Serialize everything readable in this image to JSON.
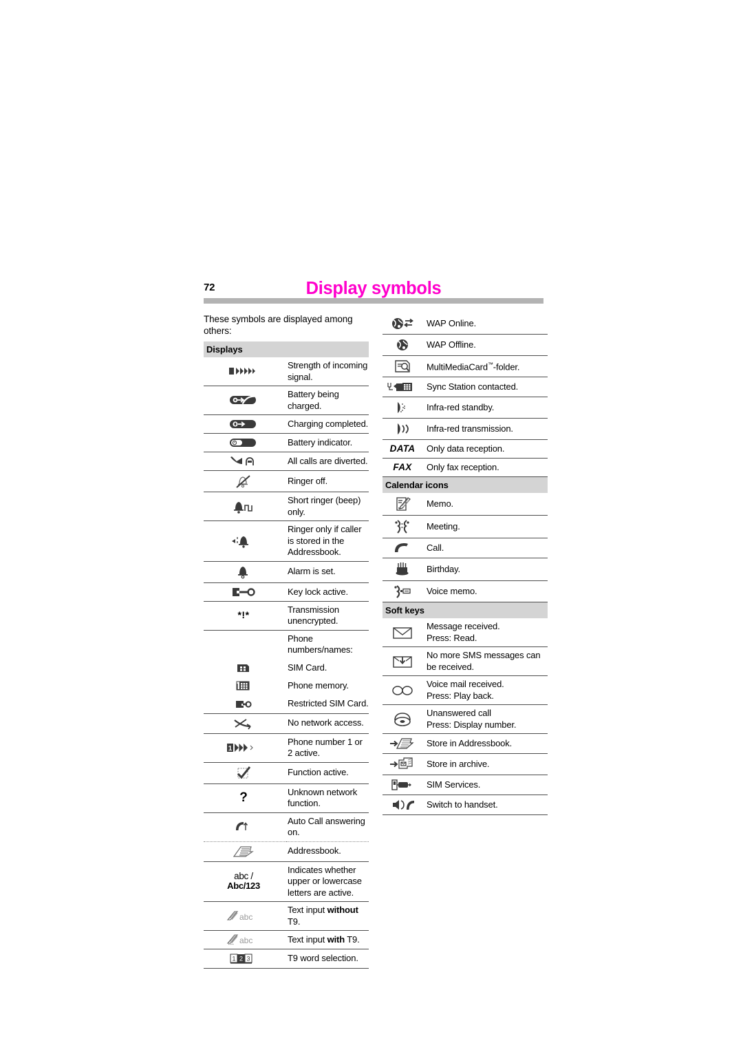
{
  "header": {
    "page_number": "72",
    "chapter_title": "Display symbols",
    "title_color": "#FF00CC",
    "rule_color": "#b3b3b3"
  },
  "intro": "These symbols are displayed among others:",
  "left_column": {
    "section_title": "Displays",
    "rows": [
      {
        "icon": "signal-strength-icon",
        "text": "Strength of incoming signal."
      },
      {
        "icon": "battery-charging-icon",
        "text": "Battery being charged."
      },
      {
        "icon": "battery-charged-icon",
        "text": "Charging completed."
      },
      {
        "icon": "battery-indicator-icon",
        "text": "Battery indicator."
      },
      {
        "icon": "call-divert-icon",
        "text": "All calls are diverted."
      },
      {
        "icon": "ringer-off-icon",
        "text": "Ringer off."
      },
      {
        "icon": "short-ringer-icon",
        "text": "Short ringer (beep) only."
      },
      {
        "icon": "ringer-addressbook-icon",
        "text": "Ringer only if caller is stored in the Addressbook."
      },
      {
        "icon": "alarm-icon",
        "text": "Alarm is set."
      },
      {
        "icon": "key-lock-icon",
        "text": "Key lock active."
      },
      {
        "icon": "unencrypted-icon",
        "text": "Transmission unencrypted.",
        "icon_text": "*!*"
      },
      {
        "icon": "none",
        "text": "Phone numbers/names:"
      },
      {
        "icon": "sim-card-icon",
        "text": "SIM Card."
      },
      {
        "icon": "phone-memory-icon",
        "text": "Phone memory."
      },
      {
        "icon": "restricted-sim-icon",
        "text": "Restricted SIM Card."
      },
      {
        "icon": "no-network-icon",
        "text": "No network access."
      },
      {
        "icon": "phone-number-active-icon",
        "text": "Phone number 1 or 2 active."
      },
      {
        "icon": "function-active-icon",
        "text": "Function active."
      },
      {
        "icon": "unknown-function-icon",
        "text": "Unknown network function.",
        "icon_text": "?"
      },
      {
        "icon": "auto-answer-icon",
        "text": "Auto Call answering on."
      },
      {
        "icon": "addressbook-icon",
        "text": "Addressbook."
      },
      {
        "icon": "case-indicator-icon",
        "text": "Indicates whether upper or lowercase letters are active.",
        "icon_text_line1": "abc /",
        "icon_text_line2": "Abc/123"
      },
      {
        "icon": "text-input-no-t9-icon",
        "text": "Text input <b>without</b> T9.",
        "icon_text": "abc"
      },
      {
        "icon": "text-input-t9-icon",
        "text": "Text input <b>with</b> T9.",
        "icon_text": "abc"
      },
      {
        "icon": "t9-word-selection-icon",
        "text": "T9 word selection."
      }
    ]
  },
  "right_column": {
    "top_rows": [
      {
        "icon": "wap-online-icon",
        "text": "WAP Online."
      },
      {
        "icon": "wap-offline-icon",
        "text": "WAP Offline."
      },
      {
        "icon": "multimediacard-folder-icon",
        "text": "MultiMediaCard™-folder."
      },
      {
        "icon": "sync-station-icon",
        "text": "Sync Station contacted."
      },
      {
        "icon": "infrared-standby-icon",
        "text": "Infra-red standby."
      },
      {
        "icon": "infrared-transmission-icon",
        "text": "Infra-red transmission."
      },
      {
        "icon": "data-reception-icon",
        "text": "Only data reception.",
        "icon_text": "DATA"
      },
      {
        "icon": "fax-reception-icon",
        "text": "Only fax reception.",
        "icon_text": "FAX"
      }
    ],
    "calendar_section_title": "Calendar icons",
    "calendar_rows": [
      {
        "icon": "memo-icon",
        "text": "Memo."
      },
      {
        "icon": "meeting-icon",
        "text": "Meeting."
      },
      {
        "icon": "call-icon",
        "text": "Call."
      },
      {
        "icon": "birthday-icon",
        "text": "Birthday."
      },
      {
        "icon": "voice-memo-icon",
        "text": "Voice memo."
      }
    ],
    "softkeys_section_title": "Soft keys",
    "softkeys_rows": [
      {
        "icon": "message-received-icon",
        "text": "Message received.\nPress: Read."
      },
      {
        "icon": "sms-full-icon",
        "text": "No more SMS messages can be received."
      },
      {
        "icon": "voice-mail-icon",
        "text": "Voice mail received.\nPress: Play back."
      },
      {
        "icon": "unanswered-call-icon",
        "text": "Unanswered call\nPress: Display number."
      },
      {
        "icon": "store-addressbook-icon",
        "text": "Store in Addressbook."
      },
      {
        "icon": "store-archive-icon",
        "text": "Store in archive."
      },
      {
        "icon": "sim-services-icon",
        "text": "SIM Services."
      },
      {
        "icon": "switch-handset-icon",
        "text": "Switch to handset."
      }
    ]
  }
}
